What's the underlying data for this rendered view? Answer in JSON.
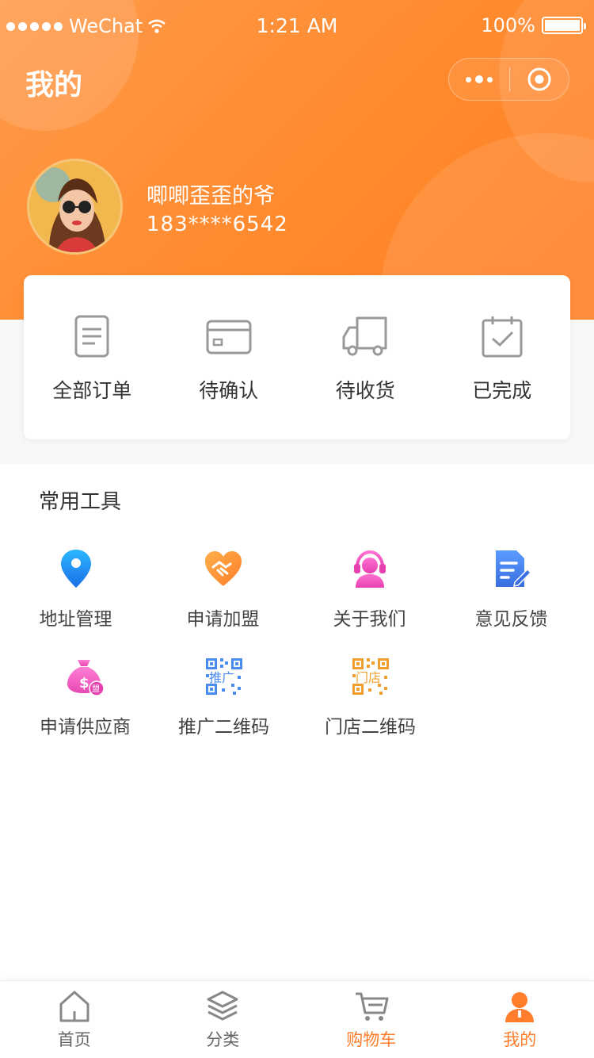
{
  "status_bar": {
    "carrier": "WeChat",
    "time": "1:21 AM",
    "battery": "100%"
  },
  "header": {
    "title": "我的"
  },
  "user": {
    "name": "唧唧歪歪的爷",
    "phone": "183****6542"
  },
  "orders": [
    {
      "label": "全部订单",
      "icon": "document-icon"
    },
    {
      "label": "待确认",
      "icon": "card-icon"
    },
    {
      "label": "待收货",
      "icon": "truck-icon"
    },
    {
      "label": "已完成",
      "icon": "calendar-check-icon"
    }
  ],
  "tools": {
    "title": "常用工具",
    "items": [
      {
        "label": "地址管理",
        "icon": "location-pin-icon",
        "color": "#1a8cf0"
      },
      {
        "label": "申请加盟",
        "icon": "handshake-heart-icon",
        "color": "#ff9a3c"
      },
      {
        "label": "关于我们",
        "icon": "customer-service-icon",
        "color": "#f45cc4"
      },
      {
        "label": "意见反馈",
        "icon": "feedback-doc-icon",
        "color": "#4b8cf0"
      },
      {
        "label": "申请供应商",
        "icon": "money-bag-icon",
        "color": "#f45cc4",
        "badge": "盟"
      },
      {
        "label": "推广二维码",
        "icon": "qrcode-icon",
        "color": "#4b8cf0",
        "overlay": "推广"
      },
      {
        "label": "门店二维码",
        "icon": "qrcode-icon",
        "color": "#f0a030",
        "overlay": "门店"
      }
    ]
  },
  "tabbar": [
    {
      "label": "首页",
      "icon": "home-icon",
      "active": false
    },
    {
      "label": "分类",
      "icon": "layers-icon",
      "active": false
    },
    {
      "label": "购物车",
      "icon": "cart-icon",
      "active": false,
      "label_color": "#ff7d2b"
    },
    {
      "label": "我的",
      "icon": "user-icon",
      "active": true
    }
  ],
  "colors": {
    "accent": "#ff8a2e",
    "tab_active": "#ff7d2b"
  }
}
